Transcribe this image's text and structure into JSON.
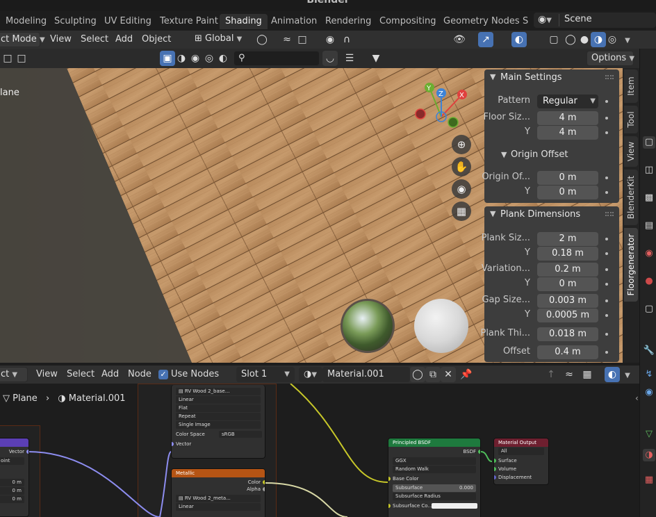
{
  "window_title": "Blender",
  "workspaces": [
    {
      "label": "Modeling"
    },
    {
      "label": "Sculpting"
    },
    {
      "label": "UV Editing"
    },
    {
      "label": "Texture Paint"
    },
    {
      "label": "Shading",
      "active": true
    },
    {
      "label": "Animation"
    },
    {
      "label": "Rendering"
    },
    {
      "label": "Compositing"
    },
    {
      "label": "Geometry Nodes"
    },
    {
      "label": "S"
    }
  ],
  "scene": {
    "label": "Scene"
  },
  "viewport_header": {
    "mode": "ct Mode",
    "menus": [
      "View",
      "Select",
      "Add",
      "Object"
    ],
    "transform_orientation": "Global"
  },
  "viewport_header2": {
    "options_label": "Options"
  },
  "viewport": {
    "object_label": "lane",
    "gizmo_axes": {
      "x": "X",
      "y": "Y",
      "z": "Z"
    }
  },
  "npanel": {
    "main_settings": {
      "title": "Main Settings",
      "pattern_label": "Pattern",
      "pattern_value": "Regular",
      "floor_size_label": "Floor Siz...",
      "floor_size_x": "4 m",
      "y_label": "Y",
      "floor_size_y": "4 m",
      "origin_offset_title": "Origin Offset",
      "origin_offset_label": "Origin Of...",
      "origin_offset_x": "0 m",
      "origin_offset_y": "0 m"
    },
    "plank_dimensions": {
      "title": "Plank Dimensions",
      "plank_size_label": "Plank Siz...",
      "plank_size_x": "2 m",
      "plank_size_y": "0.18 m",
      "variation_label": "Variation...",
      "variation_x": "0.2 m",
      "variation_y": "0 m",
      "gap_size_label": "Gap Size...",
      "gap_size_x": "0.003 m",
      "gap_size_y": "0.0005 m",
      "plank_thickness_label": "Plank Thi...",
      "plank_thickness": "0.018 m",
      "offset_label": "Offset",
      "offset": "0.4 m",
      "y_label": "Y"
    }
  },
  "side_tabs": [
    "Item",
    "Tool",
    "View",
    "BlenderKit",
    "Floorgenerator"
  ],
  "node_header": {
    "mode": "ct",
    "menus": [
      "View",
      "Select",
      "Add",
      "Node"
    ],
    "use_nodes_label": "Use Nodes",
    "slot": "Slot 1",
    "material": "Material.001"
  },
  "breadcrumb": {
    "object": "Plane",
    "material": "Material.001"
  },
  "nodes": {
    "left_node": {
      "output": "Vector",
      "dropdown": "oint",
      "values": [
        "0 m",
        "0 m",
        "0 m"
      ]
    },
    "image_top": {
      "image_name": "RV Wood 2_base...",
      "interpolation": "Linear",
      "projection": "Flat",
      "extension": "Repeat",
      "source": "Single Image",
      "color_space_label": "Color Space",
      "color_space": "sRGB",
      "vector_label": "Vector"
    },
    "metallic": {
      "title": "Metallic",
      "color_label": "Color",
      "alpha_label": "Alpha",
      "image_name": "RV Wood 2_meta...",
      "interpolation": "Linear"
    },
    "principled": {
      "title": "Principled BSDF",
      "bsdf_label": "BSDF",
      "distribution": "GGX",
      "subsurface_method": "Random Walk",
      "base_color_label": "Base Color",
      "subsurface_label": "Subsurface",
      "subsurface_value": "0.000",
      "subsurface_radius_label": "Subsurface Radius",
      "subsurface_color_label": "Subsurface Co..."
    },
    "material_output": {
      "title": "Material Output",
      "target": "All",
      "surface_label": "Surface",
      "volume_label": "Volume",
      "displacement_label": "Displacement"
    }
  },
  "colors": {
    "accent": "#4772b3",
    "principled_header": "#1e7a3e",
    "output_header": "#6e1f2f",
    "metallic_header": "#b55414",
    "axis_x": "#e0413e",
    "axis_y": "#6cae31",
    "axis_z": "#3d83d6"
  }
}
